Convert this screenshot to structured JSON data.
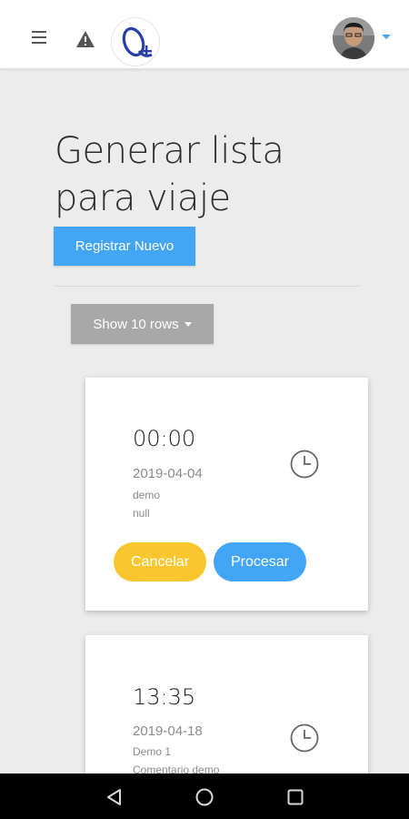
{
  "header": {
    "menu_icon": "hamburger-menu-icon",
    "warning_icon": "warning-triangle-icon",
    "logo_icon": "app-logo-q-plus",
    "avatar": "user-avatar",
    "accent_color": "#4aa3e8"
  },
  "main": {
    "title": "Generar lista para viaje",
    "register_button": "Registrar Nuevo",
    "rows_selector": "Show 10 rows"
  },
  "cards": [
    {
      "time": "00:00",
      "date": "2019-04-04",
      "name": "demo",
      "comment": "null",
      "cancel_label": "Cancelar",
      "process_label": "Procesar",
      "icon": "clock-icon"
    },
    {
      "time": "13:35",
      "date": "2019-04-18",
      "name": "Demo 1",
      "comment": "Comentario demo",
      "icon": "clock-icon"
    }
  ],
  "colors": {
    "primary": "#42a5f5",
    "warning": "#f9c62e",
    "secondary": "#a8a8a8",
    "background": "#ececec"
  },
  "system_nav": {
    "back_icon": "back-triangle-icon",
    "home_icon": "home-circle-icon",
    "recents_icon": "recents-square-icon"
  }
}
